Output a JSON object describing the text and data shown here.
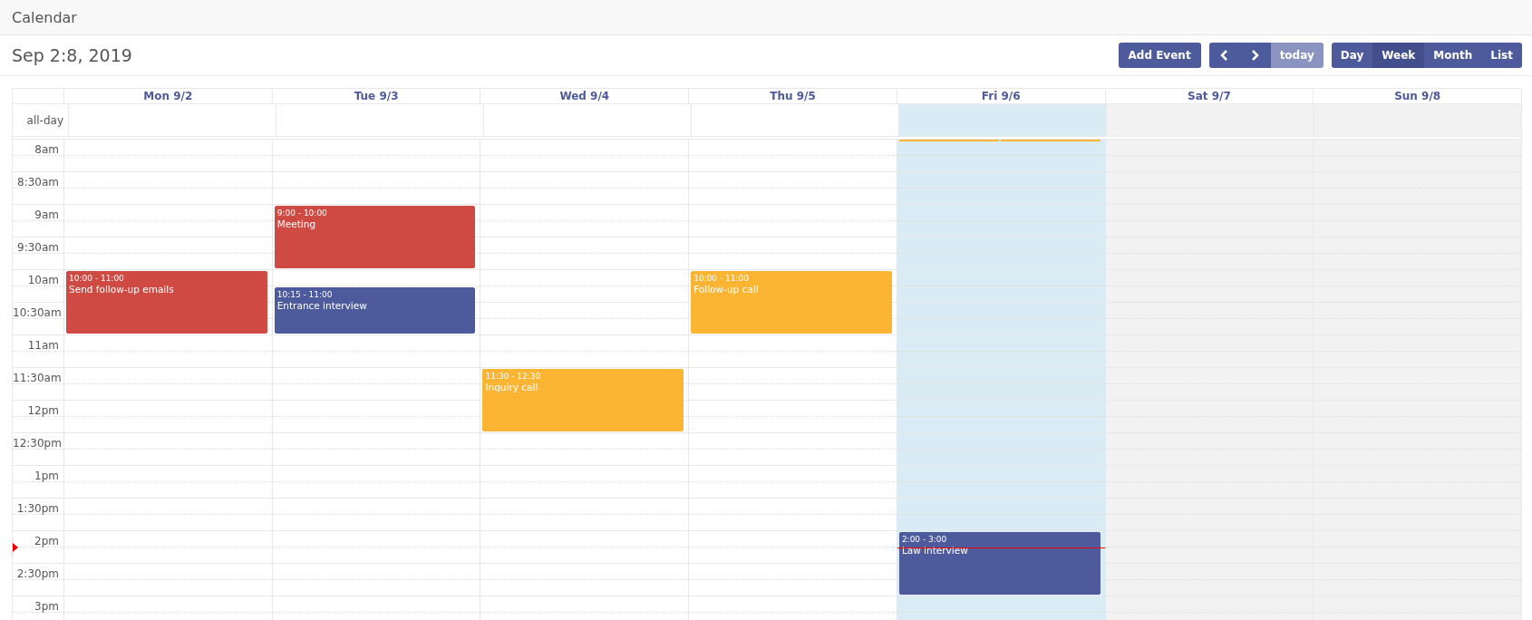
{
  "app_title": "Calendar",
  "range_title": "Sep 2:8, 2019",
  "add_button": "Add Event",
  "nav": {
    "today": {
      "label": "today",
      "disabled": true
    }
  },
  "views": [
    {
      "label": "Day",
      "selected": false
    },
    {
      "label": "Week",
      "selected": true
    },
    {
      "label": "Month",
      "selected": false
    },
    {
      "label": "List",
      "selected": false
    }
  ],
  "all_day_label": "all-day",
  "times": [
    "8am",
    "8:30am",
    "9am",
    "9:30am",
    "10am",
    "10:30am",
    "11am",
    "11:30am",
    "12pm",
    "12:30pm",
    "1pm",
    "1:30pm",
    "2pm",
    "2:30pm",
    "3pm"
  ],
  "now_indicator": true,
  "days": [
    {
      "label": "Mon 9/2",
      "kind": "weekday",
      "events": [
        {
          "time": "10:00 - 11:00",
          "title": "Send follow-up emails",
          "color": "#cf4a43"
        }
      ]
    },
    {
      "label": "Tue 9/3",
      "kind": "weekday",
      "events": [
        {
          "time": "9:00 - 10:00",
          "title": "Meeting",
          "color": "#cf4a43"
        },
        {
          "time": "10:15 - 11:00",
          "title": "Entrance interview",
          "color": "#4d5a9c"
        }
      ]
    },
    {
      "label": "Wed 9/4",
      "kind": "weekday",
      "events": [
        {
          "time": "11:30 - 12:30",
          "title": "Inquiry call",
          "color": "#fbb533"
        }
      ]
    },
    {
      "label": "Thu 9/5",
      "kind": "weekday",
      "events": [
        {
          "time": "10:00 - 11:00",
          "title": "Follow-up call",
          "color": "#fbb533"
        }
      ]
    },
    {
      "label": "Fri 9/6",
      "kind": "today",
      "hidden_marks": [
        {
          "color": "#fbb533"
        },
        {
          "color": "#fbb533"
        }
      ],
      "events": [
        {
          "time": "2:00 - 3:00",
          "title": "Law interview",
          "color": "#4d5a9c"
        }
      ]
    },
    {
      "label": "Sat 9/7",
      "kind": "weekend"
    },
    {
      "label": "Sun 9/8",
      "kind": "weekend"
    }
  ]
}
